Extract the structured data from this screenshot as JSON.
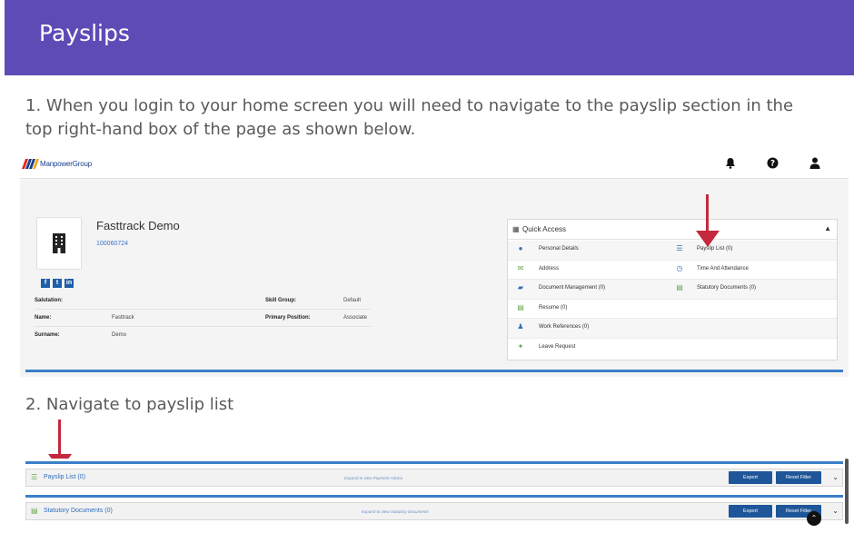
{
  "header": {
    "title": "Payslips"
  },
  "steps": {
    "step1": "1. When you login to your home screen you will need to navigate to the payslip section in the top right-hand box of the page as shown below.",
    "step2": "2. Navigate to payslip list"
  },
  "colors": {
    "header_bg": "#5f4bb6",
    "arrow": "#c3293d",
    "primary_button": "#1f5699",
    "link_blue": "#2f6fba"
  },
  "portal": {
    "logo_text": "ManpowerGroup",
    "top_icons": [
      "bell-icon",
      "help-icon",
      "user-icon"
    ],
    "profile": {
      "name": "Fasttrack Demo",
      "id": "100060724",
      "socials": [
        "f",
        "t",
        "in"
      ],
      "fields": [
        {
          "label": "Salutation:",
          "value": "",
          "label2": "Skill Group:",
          "value2": "Default"
        },
        {
          "label": "Name:",
          "value": "Fasttrack",
          "label2": "Primary Position:",
          "value2": "Associate"
        },
        {
          "label": "Surname:",
          "value": "Demo",
          "label2": "",
          "value2": ""
        }
      ]
    },
    "quick_access": {
      "title": "Quick Access",
      "left": [
        "Personal Details",
        "Address",
        "Document Management (0)",
        "Resume (0)",
        "Work References (0)",
        "Leave Request"
      ],
      "right": [
        "Payslip List (0)",
        "Time And Attendance",
        "Statutory Documents (0)"
      ]
    }
  },
  "list_panel": {
    "rows": [
      {
        "title": "Payslip List (0)",
        "hint": "Expand to view Payment Advice",
        "export": "Export",
        "reset": "Reset Filter"
      },
      {
        "title": "Statutory Documents (0)",
        "hint": "Expand to view Statutory Documents",
        "export": "Export",
        "reset": "Reset Filter"
      }
    ]
  }
}
